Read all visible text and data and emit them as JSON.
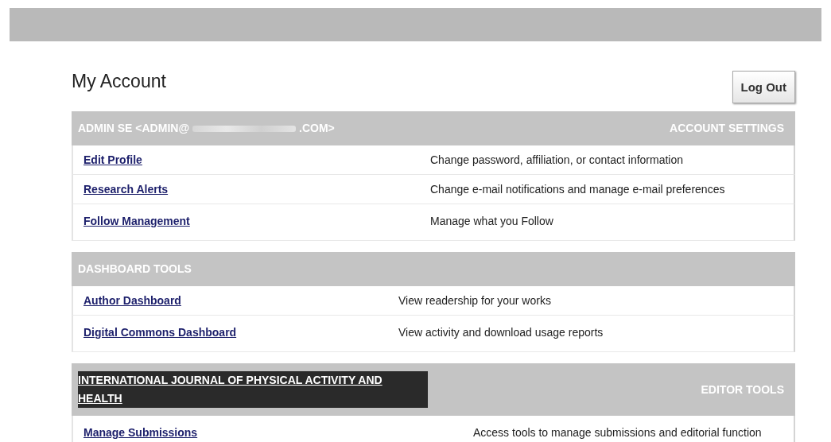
{
  "page_title": "My Account",
  "logout_button": "Log Out",
  "sections": [
    {
      "header_left": {
        "kind": "redacted",
        "before": "ADMIN SE <ADMIN@",
        "after": ".COM>"
      },
      "header_right": "ACCOUNT SETTINGS",
      "rows": [
        {
          "link": "Edit Profile",
          "description": "Change password, affiliation, or contact information"
        },
        {
          "link": "Research Alerts",
          "description": "Change e-mail notifications and manage e-mail preferences"
        },
        {
          "link": "Follow Management",
          "description": "Manage what you Follow"
        }
      ]
    },
    {
      "header_left": {
        "kind": "plain",
        "text": "DASHBOARD TOOLS"
      },
      "rows": [
        {
          "link": "Author Dashboard",
          "description": "View readership for your works"
        },
        {
          "link": "Digital Commons Dashboard",
          "description": "View activity and download usage reports"
        }
      ]
    },
    {
      "header_left": {
        "kind": "highlighted",
        "text": "INTERNATIONAL JOURNAL OF PHYSICAL ACTIVITY AND HEALTH"
      },
      "header_right": "EDITOR TOOLS",
      "rows": [
        {
          "link": "Manage Submissions",
          "description": "Access tools to manage submissions and editorial function"
        }
      ]
    }
  ]
}
